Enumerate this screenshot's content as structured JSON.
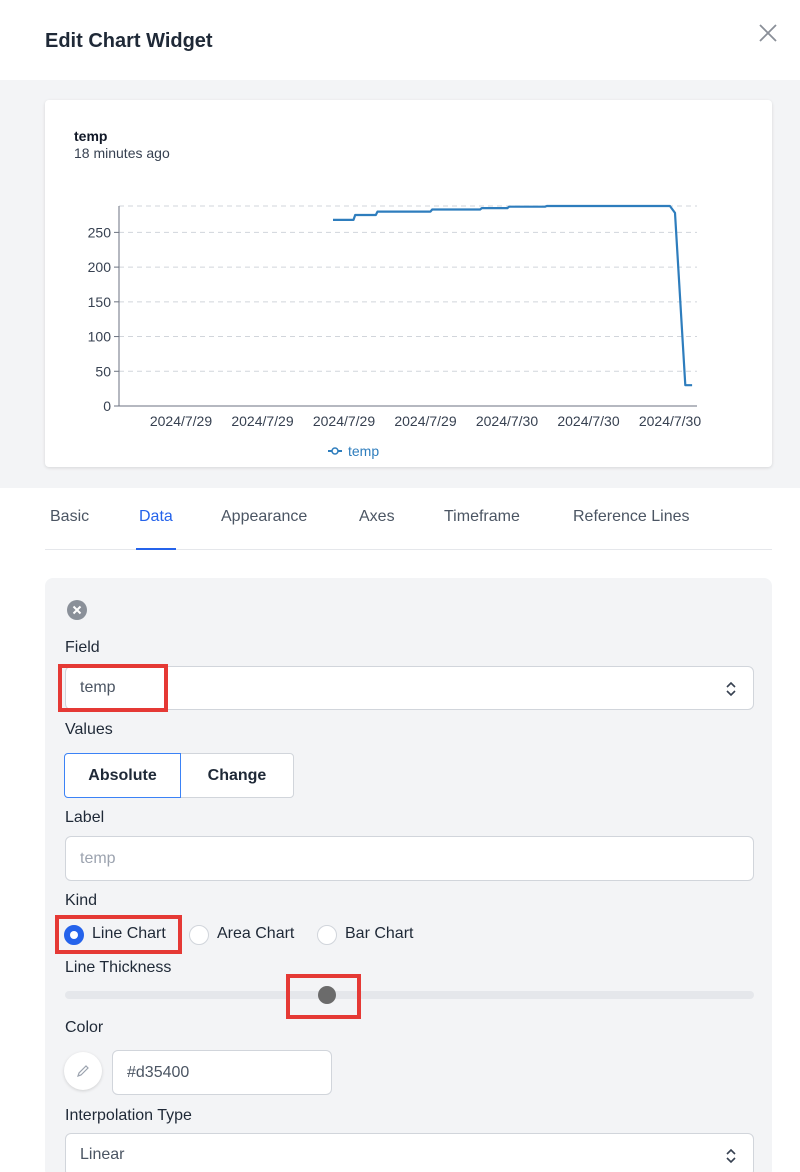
{
  "dialog": {
    "title": "Edit Chart Widget",
    "close_icon": "close-icon"
  },
  "preview": {
    "title": "temp",
    "subtitle": "18 minutes ago"
  },
  "chart_data": {
    "type": "line",
    "title": "temp",
    "subtitle": "18 minutes ago",
    "x_tick_labels": [
      "2024/7/29",
      "2024/7/29",
      "2024/7/29",
      "2024/7/29",
      "2024/7/30",
      "2024/7/30",
      "2024/7/30"
    ],
    "y_ticks": [
      0,
      50,
      100,
      150,
      200,
      250
    ],
    "ylim": [
      0,
      288
    ],
    "grid": true,
    "legend_position": "bottom",
    "series": [
      {
        "name": "temp",
        "color": "#2e7dbd",
        "points": [
          [
            0.0,
            268
          ],
          [
            0.06,
            268
          ],
          [
            0.065,
            275
          ],
          [
            0.125,
            275
          ],
          [
            0.13,
            280
          ],
          [
            0.285,
            280
          ],
          [
            0.29,
            283
          ],
          [
            0.43,
            283
          ],
          [
            0.435,
            285
          ],
          [
            0.51,
            285
          ],
          [
            0.515,
            287
          ],
          [
            0.62,
            287
          ],
          [
            0.625,
            288
          ],
          [
            0.985,
            288
          ],
          [
            1.0,
            278
          ],
          [
            1.03,
            30
          ],
          [
            1.05,
            30
          ]
        ]
      }
    ]
  },
  "tabs": [
    "Basic",
    "Data",
    "Appearance",
    "Axes",
    "Timeframe",
    "Reference Lines"
  ],
  "active_tab": "Data",
  "form": {
    "field_label": "Field",
    "field_value": "temp",
    "values_label": "Values",
    "values_options": [
      "Absolute",
      "Change"
    ],
    "values_selected": "Absolute",
    "label_label": "Label",
    "label_placeholder": "temp",
    "kind_label": "Kind",
    "kind_options": [
      "Line Chart",
      "Area Chart",
      "Bar Chart"
    ],
    "kind_selected": "Line Chart",
    "thickness_label": "Line Thickness",
    "thickness_level": 0.38,
    "color_label": "Color",
    "color_value": "#d35400",
    "interp_label": "Interpolation Type",
    "interp_value": "Linear"
  }
}
